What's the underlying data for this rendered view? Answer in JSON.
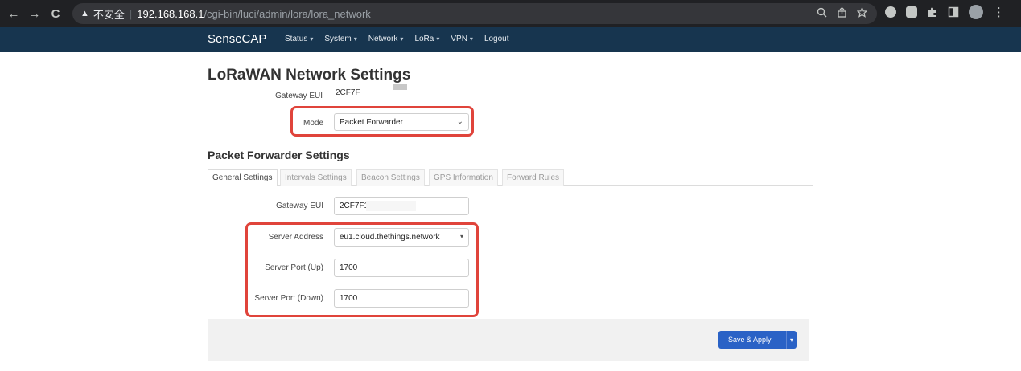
{
  "browser": {
    "back": "←",
    "forward": "→",
    "reload": "C",
    "warning_icon": "▲",
    "insecure_label": "不安全",
    "url_host": "192.168.168.1",
    "url_path": "/cgi-bin/luci/admin/lora/lora_network"
  },
  "navbar": {
    "brand": "SenseCAP",
    "menu": [
      {
        "label": "Status",
        "has_caret": true
      },
      {
        "label": "System",
        "has_caret": true
      },
      {
        "label": "Network",
        "has_caret": true
      },
      {
        "label": "LoRa",
        "has_caret": true
      },
      {
        "label": "VPN",
        "has_caret": true
      },
      {
        "label": "Logout",
        "has_caret": false
      }
    ],
    "caret": "▾"
  },
  "page": {
    "title": "LoRaWAN Network Settings",
    "gateway_eui_label": "Gateway EUI",
    "gateway_eui_value": "2CF7F",
    "mode_label": "Mode",
    "mode_value": "Packet Forwarder",
    "section_title": "Packet Forwarder Settings",
    "tabs": [
      {
        "label": "General Settings",
        "active": true
      },
      {
        "label": "Intervals Settings",
        "active": false
      },
      {
        "label": "Beacon Settings",
        "active": false
      },
      {
        "label": "GPS Information",
        "active": false
      },
      {
        "label": "Forward Rules",
        "active": false
      }
    ],
    "pf_gateway_eui_label": "Gateway EUI",
    "pf_gateway_eui_value": "2CF7F1",
    "server_address_label": "Server Address",
    "server_address_value": "eu1.cloud.thethings.network",
    "server_port_up_label": "Server Port (Up)",
    "server_port_up_value": "1700",
    "server_port_down_label": "Server Port (Down)",
    "server_port_down_value": "1700",
    "save_apply_label": "Save & Apply"
  },
  "colors": {
    "navbar": "#17354f",
    "highlight": "#e0443b",
    "primary_button": "#2a62c6"
  }
}
